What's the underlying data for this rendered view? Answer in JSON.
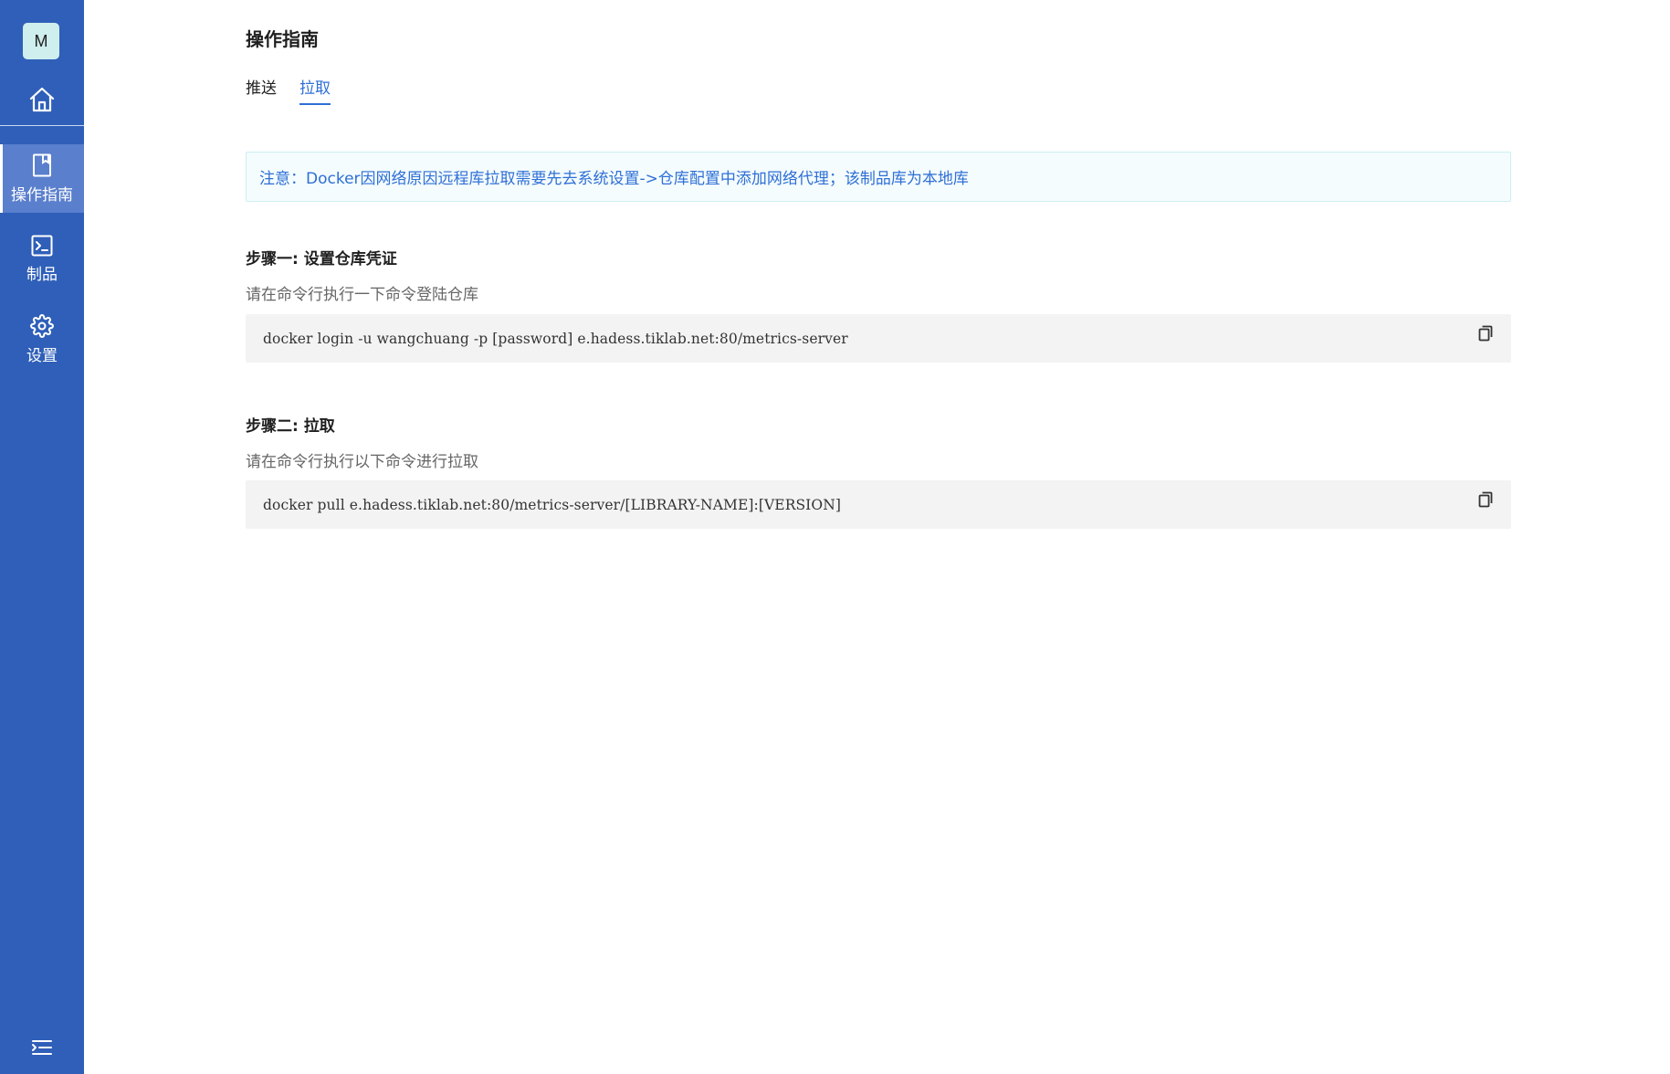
{
  "sidebar": {
    "avatar_letter": "M",
    "items": [
      {
        "label": "操作指南",
        "icon": "book-icon",
        "active": true
      },
      {
        "label": "制品",
        "icon": "terminal-icon",
        "active": false
      },
      {
        "label": "设置",
        "icon": "gear-icon",
        "active": false
      }
    ]
  },
  "main": {
    "title": "操作指南",
    "tabs": [
      {
        "label": "推送",
        "active": false
      },
      {
        "label": "拉取",
        "active": true
      }
    ],
    "notice": "注意：Docker因网络原因远程库拉取需要先去系统设置->仓库配置中添加网络代理；该制品库为本地库",
    "steps": [
      {
        "title": "步骤一: 设置仓库凭证",
        "description": "请在命令行执行一下命令登陆仓库",
        "command": "docker login -u wangchuang -p [password] e.hadess.tiklab.net:80/metrics-server"
      },
      {
        "title": "步骤二: 拉取",
        "description": "请在命令行执行以下命令进行拉取",
        "command": "docker pull e.hadess.tiklab.net:80/metrics-server/[LIBRARY-NAME]:[VERSION]"
      }
    ]
  },
  "colors": {
    "sidebar_bg": "#2f5fb8",
    "sidebar_active": "#5a7fcd",
    "accent": "#2f6fd6",
    "notice_bg": "#f4fcfd",
    "code_bg": "#f3f3f3"
  }
}
